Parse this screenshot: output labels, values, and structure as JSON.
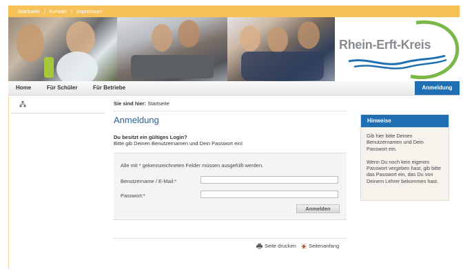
{
  "top_links": [
    "Startseite",
    "Kontakt",
    "Impressum"
  ],
  "logo": {
    "text": "Rhein-Erft-Kreis",
    "colors": {
      "green": "#7ab648",
      "blue": "#1f6fb2"
    }
  },
  "nav": {
    "items": [
      "Home",
      "Für Schüler",
      "Für Betriebe"
    ],
    "login_tab": "Anmeldung"
  },
  "breadcrumb": {
    "prefix": "Sie sind hier:",
    "current": "Startseite"
  },
  "main": {
    "title": "Anmeldung",
    "intro_heading": "Du besitzt ein gültiges Login?",
    "intro_text": "Bitte gib Deinen Benutzernamen und Dein Passwort ein!"
  },
  "form": {
    "required_note": "Alle mit * gekennzeichneten Felder müssen ausgefüllt werden.",
    "username_label": "Benutzername / E-Mail:*",
    "username_value": "",
    "password_label": "Passwort:*",
    "password_value": "",
    "submit_label": "Anmelden"
  },
  "footer": {
    "print_label": "Seite drucken",
    "top_label": "Seitenanfang"
  },
  "sidebar": {
    "title": "Hinweise",
    "paragraphs": [
      "Gib hier bitte Deinen Benutzernamen und Dein Passwort ein.",
      "Wenn Du noch kein eigenes Passwort vergeben hast, gib bitte das Passwort ein, das Du von Deinem Lehrer bekommen hast."
    ]
  },
  "colors": {
    "topbar": "#f6c258",
    "accent_blue": "#1f6fb2",
    "title_blue": "#2f5f92"
  }
}
